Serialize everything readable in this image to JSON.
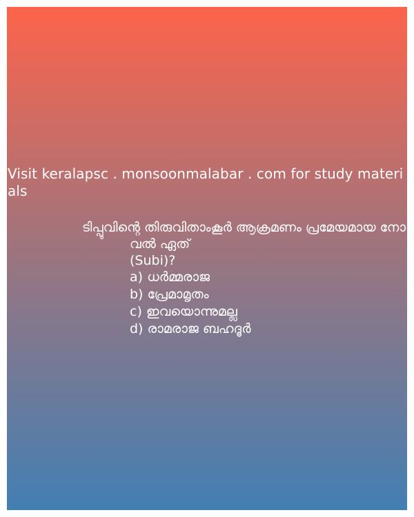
{
  "promo_text": "Visit keralapsc . monsoonmalabar . com for study materials",
  "question": {
    "line1": "ടിപ്പുവിന്റെ തിരുവിതാംകൂർ ആക്രമണം പ്രമേയമായ നോ",
    "line2": "വൽ ഏത്",
    "line3": "(Subi)?"
  },
  "options": [
    "a) ധർമ്മരാജ",
    "b) പ്രേമാമൃതം",
    "c) ഇവയൊന്നുമല്ല",
    "d) രാമരാജ ബഹദൂർ"
  ],
  "colors": {
    "gradient_top": "#fd644b",
    "gradient_mid": "#9a7580",
    "gradient_bottom": "#437fb3",
    "text": "#ffffff"
  }
}
